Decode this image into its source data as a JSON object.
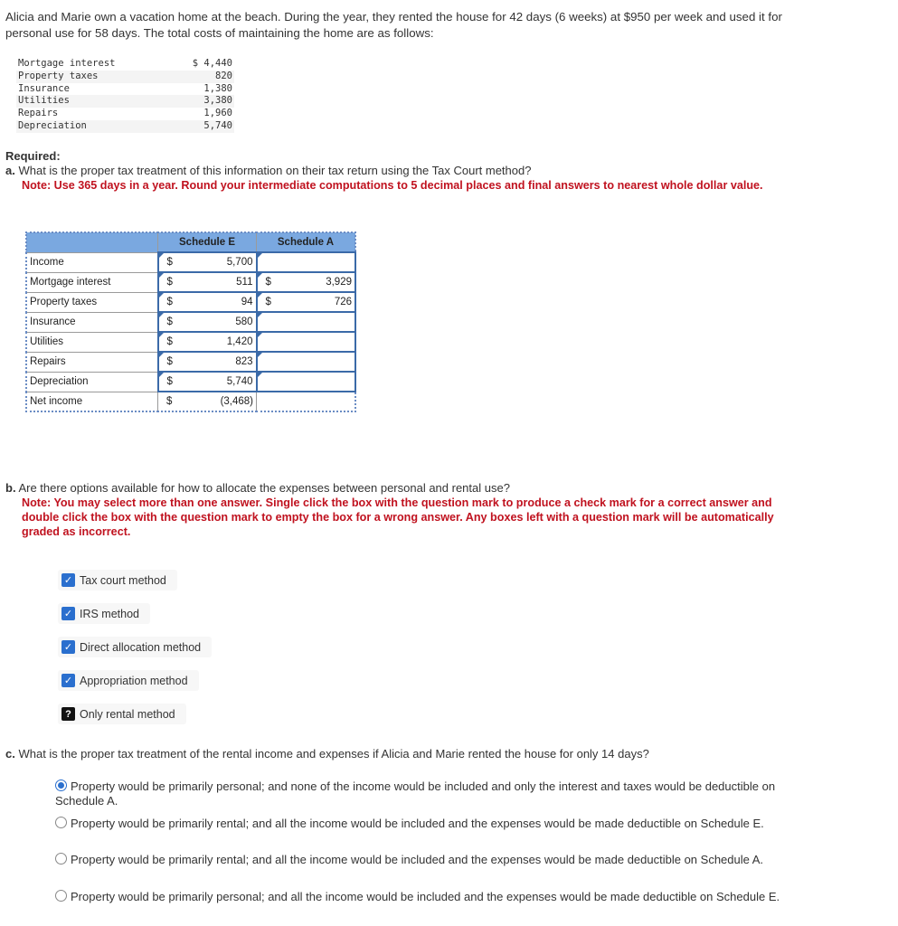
{
  "intro": "Alicia and Marie own a vacation home at the beach. During the year, they rented the house for 42 days (6 weeks) at $950 per week and used it for personal use for 58 days. The total costs of maintaining the home are as follows:",
  "costs": [
    {
      "label": "Mortgage interest",
      "value": "$ 4,440"
    },
    {
      "label": "Property taxes",
      "value": "820"
    },
    {
      "label": "Insurance",
      "value": "1,380"
    },
    {
      "label": "Utilities",
      "value": "3,380"
    },
    {
      "label": "Repairs",
      "value": "1,960"
    },
    {
      "label": "Depreciation",
      "value": "5,740"
    }
  ],
  "required_label": "Required:",
  "part_a": {
    "letter": "a.",
    "question": "What is the proper tax treatment of this information on their tax return using the Tax Court method?",
    "note": "Note: Use 365 days in a year. Round your intermediate computations to 5 decimal places and final answers to nearest whole dollar value.",
    "table": {
      "headers": [
        "",
        "Schedule E",
        "Schedule A"
      ],
      "currency": "$",
      "rows": [
        {
          "label": "Income",
          "e": "5,700",
          "a": ""
        },
        {
          "label": "Mortgage interest",
          "e": "511",
          "a": "3,929"
        },
        {
          "label": "Property taxes",
          "e": "94",
          "a": "726"
        },
        {
          "label": "Insurance",
          "e": "580",
          "a": ""
        },
        {
          "label": "Utilities",
          "e": "1,420",
          "a": ""
        },
        {
          "label": "Repairs",
          "e": "823",
          "a": ""
        },
        {
          "label": "Depreciation",
          "e": "5,740",
          "a": ""
        },
        {
          "label": "Net income",
          "e": "(3,468)",
          "a": ""
        }
      ]
    }
  },
  "part_b": {
    "letter": "b.",
    "question": "Are there options available for how to allocate the expenses between personal and rental use?",
    "note": "Note: You may select more than one answer. Single click the box with the question mark to produce a check mark for a correct answer and double click the box with the question mark to empty the box for a wrong answer. Any boxes left with a question mark will be automatically graded as incorrect.",
    "options": [
      {
        "label": "Tax court method",
        "state": "checked"
      },
      {
        "label": "IRS method",
        "state": "checked"
      },
      {
        "label": "Direct allocation method",
        "state": "checked"
      },
      {
        "label": "Appropriation method",
        "state": "checked"
      },
      {
        "label": "Only rental method",
        "state": "unknown"
      }
    ]
  },
  "part_c": {
    "letter": "c.",
    "question": "What is the proper tax treatment of the rental income and expenses if Alicia and Marie rented the house for only 14 days?",
    "options": [
      {
        "label": "Property would be primarily personal; and none of the income would be included and only the interest and taxes would be deductible on Schedule A.",
        "selected": true
      },
      {
        "label": "Property would be primarily rental; and all the income would be included and the expenses would be made deductible on Schedule E.",
        "selected": false
      },
      {
        "label": "Property would be primarily rental; and all the income would be included and the expenses would be made deductible on Schedule A.",
        "selected": false
      },
      {
        "label": "Property would be primarily personal; and all the income would be included and the expenses would be made deductible on Schedule E.",
        "selected": false
      }
    ]
  }
}
